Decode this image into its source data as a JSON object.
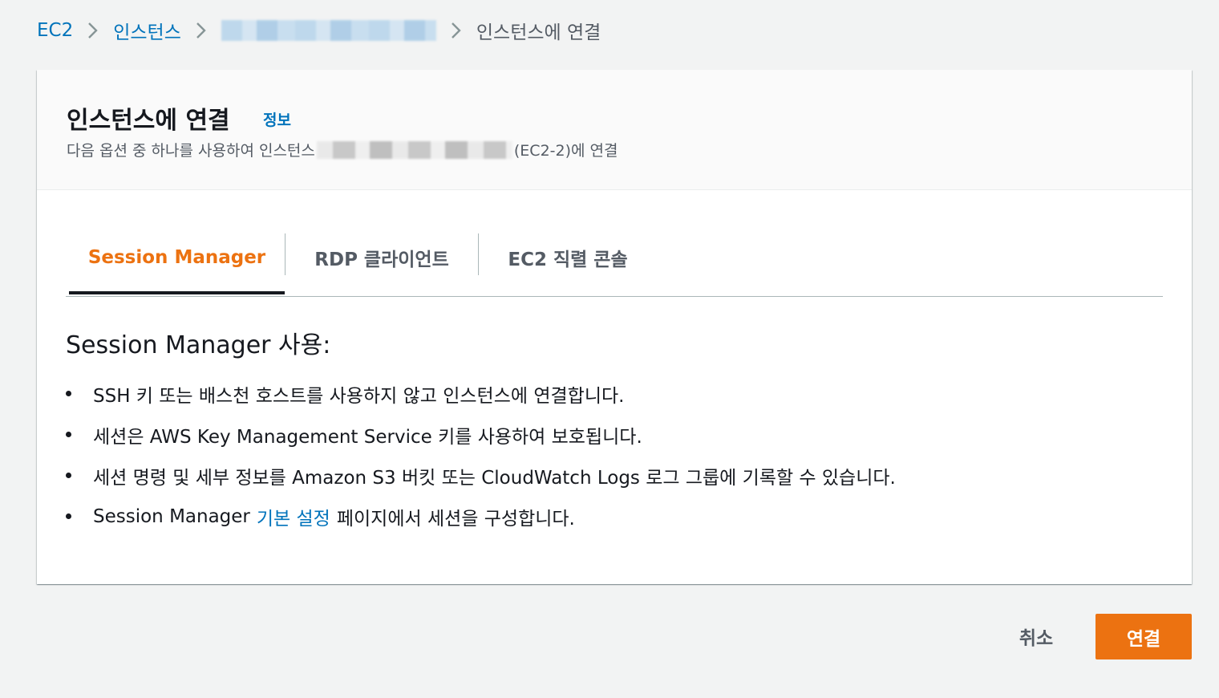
{
  "breadcrumb": {
    "items": [
      "EC2",
      "인스턴스"
    ],
    "current": "인스턴스에 연결"
  },
  "header": {
    "title": "인스턴스에 연결",
    "info_label": "정보",
    "description_prefix": "다음 옵션 중 하나를 사용하여 인스턴스",
    "description_suffix": "(EC2-2)에 연결"
  },
  "tabs": [
    {
      "label": "Session Manager",
      "active": true
    },
    {
      "label": "RDP 클라이언트",
      "active": false
    },
    {
      "label": "EC2 직렬 콘솔",
      "active": false
    }
  ],
  "content": {
    "title": "Session Manager 사용:",
    "bullets": [
      "SSH 키 또는 배스천 호스트를 사용하지 않고 인스턴스에 연결합니다.",
      "세션은 AWS Key Management Service 키를 사용하여 보호됩니다.",
      "세션 명령 및 세부 정보를 Amazon S3 버킷 또는 CloudWatch Logs 로그 그룹에 기록할 수 있습니다."
    ],
    "last_bullet": {
      "prefix": "Session Manager",
      "link": "기본 설정",
      "suffix": "페이지에서 세션을 구성합니다."
    }
  },
  "footer": {
    "cancel_label": "취소",
    "connect_label": "연결"
  },
  "colors": {
    "accent": "#ec7211",
    "link": "#0073bb",
    "background": "#f2f3f3"
  },
  "icons": [
    "chevron-right-icon"
  ]
}
